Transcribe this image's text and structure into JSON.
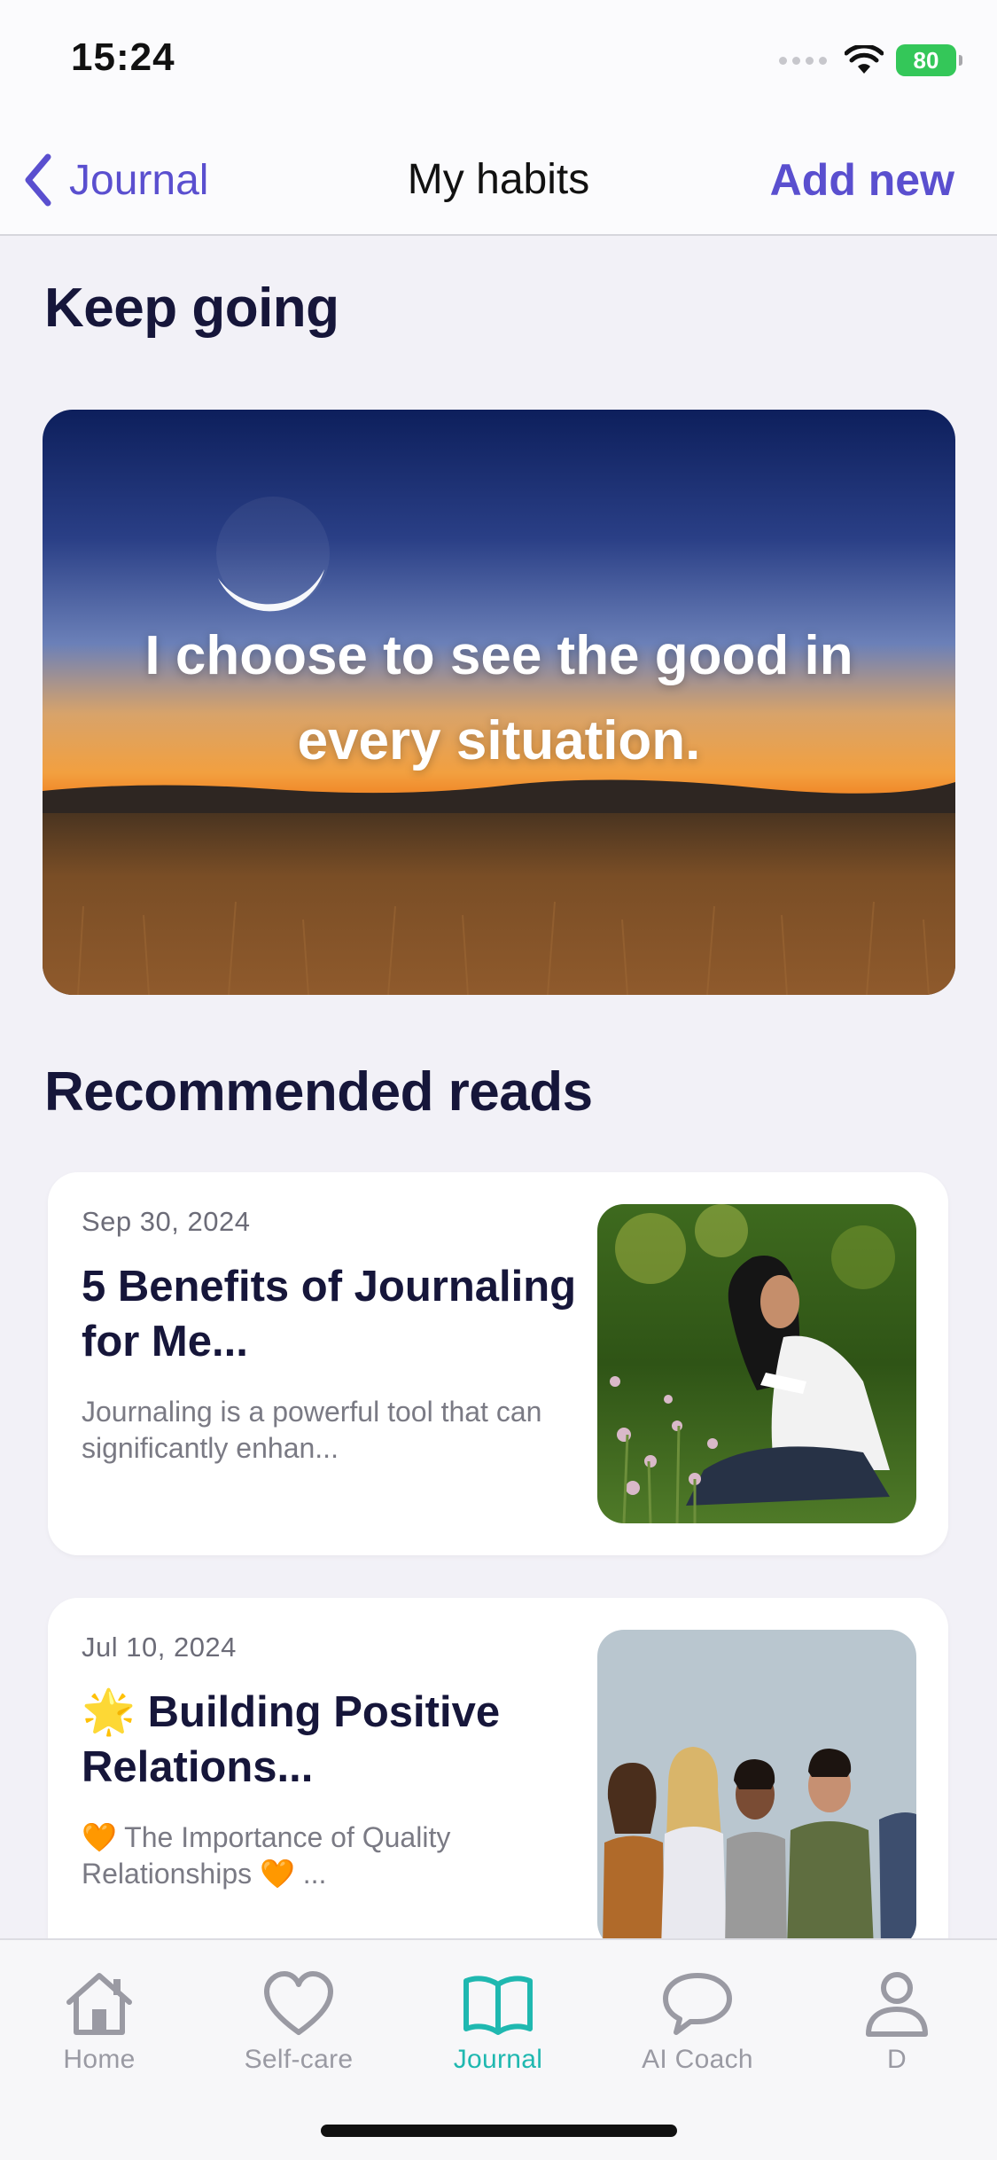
{
  "status_bar": {
    "time": "15:24",
    "battery": "80",
    "battery_color": "#34c759"
  },
  "nav": {
    "back_label": "Journal",
    "title": "My habits",
    "action_label": "Add new",
    "accent": "#5a4fcf"
  },
  "sections": {
    "keep_going": "Keep going",
    "recommended": "Recommended reads"
  },
  "hero": {
    "quote": "I choose to see the good in every situation."
  },
  "articles": [
    {
      "date": "Sep 30, 2024",
      "title": "5 Benefits of Journaling for Me...",
      "excerpt": "Journaling is a powerful tool that can significantly enhan...",
      "thumb": "woman-in-meadow-photo"
    },
    {
      "date": "Jul 10, 2024",
      "title": "🌟 Building Positive Relations...",
      "excerpt": "🧡 The Importance of Quality Relationships 🧡 ...",
      "thumb": "group-of-friends-photo"
    }
  ],
  "tabs": [
    {
      "label": "Home",
      "icon": "home-icon",
      "active": false
    },
    {
      "label": "Self-care",
      "icon": "heart-icon",
      "active": false
    },
    {
      "label": "Journal",
      "icon": "book-icon",
      "active": true
    },
    {
      "label": "AI Coach",
      "icon": "chat-bubble-icon",
      "active": false
    },
    {
      "label": "D",
      "icon": "person-icon",
      "active": false
    }
  ],
  "colors": {
    "tab_active": "#1fb8b0",
    "tab_inactive": "#9a9aa3",
    "heading": "#16163a"
  }
}
